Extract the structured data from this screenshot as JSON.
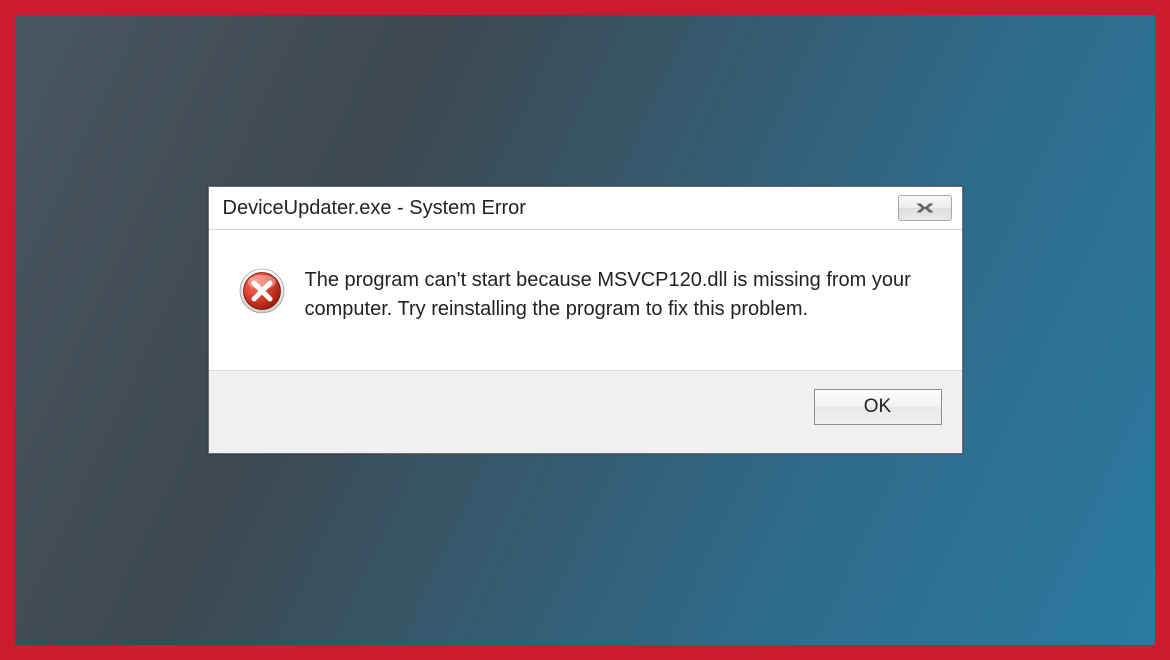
{
  "dialog": {
    "title": "DeviceUpdater.exe - System Error",
    "message": "The program can't start because MSVCP120.dll is missing from your computer. Try reinstalling the program to fix this problem.",
    "ok_label": "OK",
    "close_glyph": "✕"
  },
  "colors": {
    "border_red": "#cc1a2e",
    "error_icon_red": "#d03a2a",
    "error_icon_dark": "#9a1e10"
  }
}
